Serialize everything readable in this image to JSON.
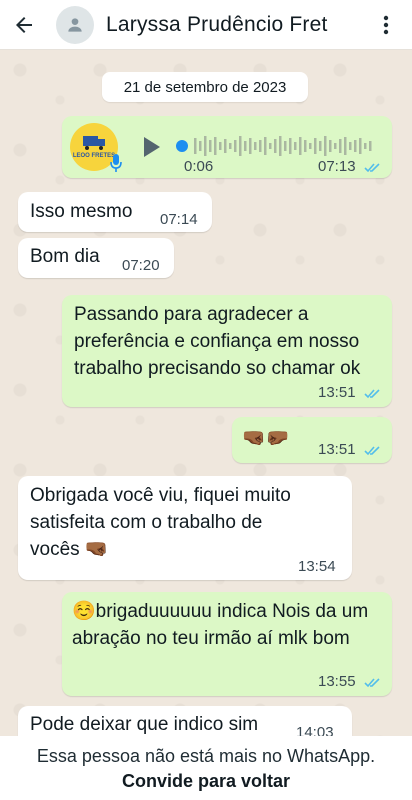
{
  "header": {
    "contact_name": "Laryssa Prudêncio Fret"
  },
  "chat": {
    "date_label": "21 de setembro de 2023",
    "voice_message": {
      "avatar_text": "LEOO FRETES",
      "duration": "0:06",
      "time": "07:13",
      "status": "read",
      "play_icon": "play-icon",
      "mic_icon": "mic-icon"
    },
    "messages": [
      {
        "direction": "incoming",
        "text": "Isso mesmo",
        "time": "07:14"
      },
      {
        "direction": "incoming",
        "text": "Bom dia",
        "time": "07:20"
      },
      {
        "direction": "outgoing",
        "text": "Passando para agradecer a preferência e confiança em nosso trabalho precisando so chamar ok",
        "time": "13:51",
        "status": "read"
      },
      {
        "direction": "outgoing",
        "text": "🤜🏾🤛🏾",
        "time": "13:51",
        "status": "read"
      },
      {
        "direction": "incoming",
        "text": "Obrigada você viu, fiquei muito satisfeita com o trabalho de vocês 🤜🏾",
        "time": "13:54"
      },
      {
        "direction": "outgoing",
        "text": "☺️brigaduuuuuu indica Nois da um abração  no teu irmão aí  mlk bom",
        "time": "13:55",
        "status": "read"
      },
      {
        "direction": "incoming",
        "text": "Pode deixar que indico sim",
        "time": "14:03"
      }
    ]
  },
  "footer": {
    "info": "Essa pessoa não está mais no WhatsApp.",
    "action": "Convide para voltar"
  },
  "colors": {
    "outgoing_bubble": "#dcf8c6",
    "incoming_bubble": "#ffffff",
    "read_ticks": "#53bdeb",
    "voice_dot": "#1d8ef0"
  }
}
